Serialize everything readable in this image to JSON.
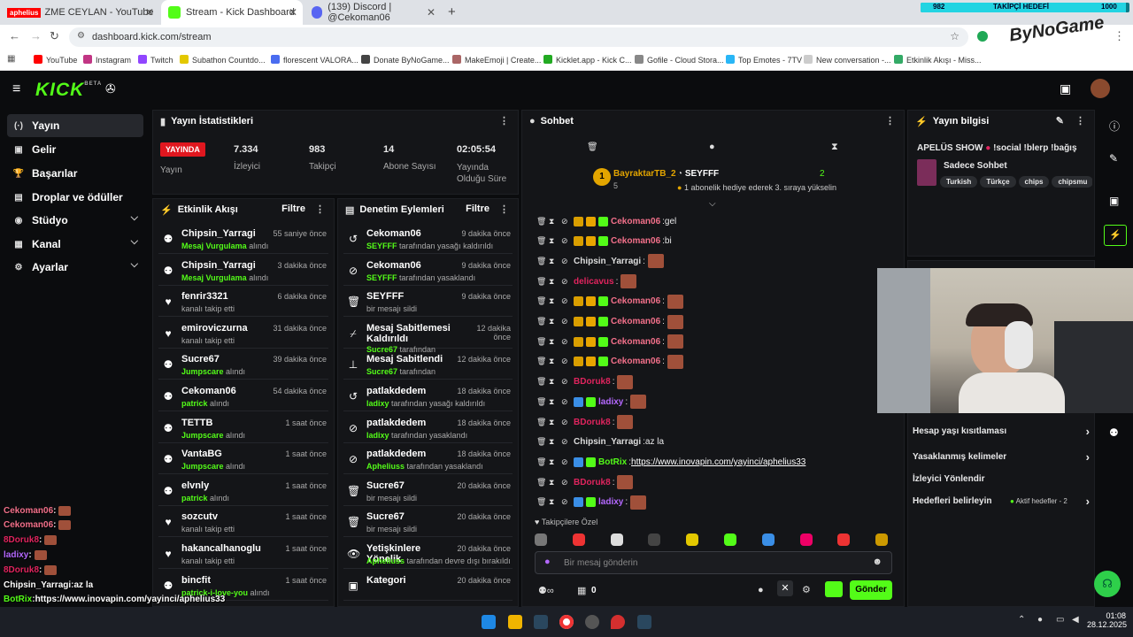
{
  "browser": {
    "tabs": [
      {
        "label": "ZME CEYLAN - YouTube",
        "prefix": "aphelius",
        "color": "#ff0000"
      },
      {
        "label": "Stream - Kick Dashboard",
        "color": "#53fc18"
      },
      {
        "label": "(139) Discord | @Cekoman06",
        "color": "#5865f2"
      }
    ],
    "new_tab": "+",
    "url": "dashboard.kick.com/stream",
    "bookmarks": [
      "YouTube",
      "Instagram",
      "Twitch",
      "Subathon Countdo...",
      "florescent VALORA...",
      "Donate ByNoGame...",
      "MakeEmoji | Create...",
      "Kicklet.app - Kick C...",
      "Gofile - Cloud Stora...",
      "Top Emotes - 7TV",
      "New conversation -...",
      "Etkinlik Akışı - Miss..."
    ]
  },
  "follower_goal": {
    "current": "982",
    "label": "TAKİPÇİ HEDEFİ",
    "target": "1000",
    "progress": 0.982
  },
  "brand_overlay": "ByNoGame",
  "kick": {
    "logo": "KICK",
    "beta": "BETA"
  },
  "sidebar": [
    {
      "label": "Yayın",
      "icon": "broadcast-icon",
      "glyph": "(·)",
      "active": true
    },
    {
      "label": "Gelir",
      "icon": "revenue-icon",
      "glyph": "▣"
    },
    {
      "label": "Başarılar",
      "icon": "trophy-icon",
      "glyph": "🏆"
    },
    {
      "label": "Droplar ve ödüller",
      "icon": "gift-icon",
      "glyph": "▤"
    },
    {
      "label": "Stüdyo",
      "icon": "studio-icon",
      "glyph": "◉",
      "chevron": true
    },
    {
      "label": "Kanal",
      "icon": "channel-icon",
      "glyph": "▦",
      "chevron": true
    },
    {
      "label": "Ayarlar",
      "icon": "settings-icon",
      "glyph": "⚙",
      "chevron": true
    }
  ],
  "stats": {
    "title": "Yayın İstatistikleri",
    "live_badge": "YAYINDA",
    "items": [
      {
        "value": "",
        "label": "Yayın"
      },
      {
        "value": "7.334",
        "label": "İzleyici"
      },
      {
        "value": "983",
        "label": "Takipçi"
      },
      {
        "value": "14",
        "label": "Abone Sayısı"
      },
      {
        "value": "02:05:54",
        "label": "Yayında Olduğu Süre"
      }
    ]
  },
  "activity": {
    "title": "Etkinlik Akışı",
    "filter": "Filtre",
    "rows": [
      {
        "name": "Chipsin_Yarragi",
        "hl": "Mesaj Vurgulama",
        "rest": " alındı",
        "time": "55 saniye önce",
        "glyph": "⚉"
      },
      {
        "name": "Chipsin_Yarragi",
        "hl": "Mesaj Vurgulama",
        "rest": " alındı",
        "time": "3 dakika önce",
        "glyph": "⚉"
      },
      {
        "name": "fenrir3321",
        "hl": "",
        "rest": "kanalı takip etti",
        "time": "6 dakika önce",
        "glyph": "♥"
      },
      {
        "name": "emiroviczurna",
        "hl": "",
        "rest": "kanalı takip etti",
        "time": "31 dakika önce",
        "glyph": "♥"
      },
      {
        "name": "Sucre67",
        "hl": "Jumpscare",
        "rest": " alındı",
        "time": "39 dakika önce",
        "glyph": "⚉"
      },
      {
        "name": "Cekoman06",
        "hl": "patrick",
        "rest": " alındı",
        "time": "54 dakika önce",
        "glyph": "⚉"
      },
      {
        "name": "TETTB",
        "hl": "Jumpscare",
        "rest": " alındı",
        "time": "1 saat önce",
        "glyph": "⚉"
      },
      {
        "name": "VantaBG",
        "hl": "Jumpscare",
        "rest": " alındı",
        "time": "1 saat önce",
        "glyph": "⚉"
      },
      {
        "name": "elvnly",
        "hl": "patrick",
        "rest": " alındı",
        "time": "1 saat önce",
        "glyph": "⚉"
      },
      {
        "name": "sozcutv",
        "hl": "",
        "rest": "kanalı takip etti",
        "time": "1 saat önce",
        "glyph": "♥"
      },
      {
        "name": "hakancalhanoglu",
        "hl": "",
        "rest": "kanalı takip etti",
        "time": "1 saat önce",
        "glyph": "♥"
      },
      {
        "name": "bincfit",
        "hl": "patrick-i-love-you",
        "rest": " alındı",
        "time": "1 saat önce",
        "glyph": "⚉"
      }
    ]
  },
  "moderation": {
    "title": "Denetim Eylemleri",
    "filter": "Filtre",
    "rows": [
      {
        "name": "Cekoman06",
        "hl": "SEYFFF",
        "rest": " tarafından yasağı kaldırıldı",
        "time": "9 dakika önce",
        "glyph": "↺"
      },
      {
        "name": "Cekoman06",
        "hl": "SEYFFF",
        "rest": " tarafından yasaklandı",
        "time": "9 dakika önce",
        "glyph": "⊘"
      },
      {
        "name": "SEYFFF",
        "hl": "",
        "rest": "bir mesajı sildi",
        "time": "9 dakika önce",
        "glyph": "🗑"
      },
      {
        "name": "Mesaj Sabitlemesi Kaldırıldı",
        "hl": "Sucre67",
        "rest": " tarafından",
        "time": "12 dakika önce",
        "glyph": "⌿"
      },
      {
        "name": "Mesaj Sabitlendi",
        "hl": "Sucre67",
        "rest": " tarafından",
        "time": "12 dakika önce",
        "glyph": "⊥"
      },
      {
        "name": "patlakdedem",
        "hl": "ladixy",
        "rest": " tarafından yasağı kaldırıldı",
        "time": "18 dakika önce",
        "glyph": "↺"
      },
      {
        "name": "patlakdedem",
        "hl": "ladixy",
        "rest": " tarafından yasaklandı",
        "time": "18 dakika önce",
        "glyph": "⊘"
      },
      {
        "name": "patlakdedem",
        "hl": "Apheliuss",
        "rest": " tarafından yasaklandı",
        "time": "18 dakika önce",
        "glyph": "⊘"
      },
      {
        "name": "Sucre67",
        "hl": "",
        "rest": "bir mesajı sildi",
        "time": "20 dakika önce",
        "glyph": "🗑"
      },
      {
        "name": "Sucre67",
        "hl": "",
        "rest": "bir mesajı sildi",
        "time": "20 dakika önce",
        "glyph": "🗑"
      },
      {
        "name": "Yetişkinlere Yönelik",
        "hl": "Apheliuss",
        "rest": " tarafından devre dışı bırakıldı",
        "time": "20 dakika önce",
        "glyph": "👁"
      },
      {
        "name": "Kategori",
        "hl": "",
        "rest": "",
        "time": "20 dakika önce",
        "glyph": "▣"
      }
    ]
  },
  "chat": {
    "title": "Sohbet",
    "pinned": {
      "user1": "BayraktarTB_2",
      "count1": "5",
      "user2": "SEYFFF",
      "count2": "2",
      "desc": "1 abonelik hediye ederek 3. sıraya yükselin",
      "rank": "1"
    },
    "lines": [
      {
        "user": "Cekoman06",
        "color": "#f2708a",
        "text": "gel",
        "emote": false,
        "badges": [
          "#d99e00",
          "#e8a500",
          "#53fc18"
        ]
      },
      {
        "user": "Cekoman06",
        "color": "#f2708a",
        "text": "bi",
        "emote": false,
        "badges": [
          "#d99e00",
          "#e8a500",
          "#53fc18"
        ]
      },
      {
        "user": "Chipsin_Yarragi",
        "color": "#dddddd",
        "text": "",
        "emote": true,
        "badges": []
      },
      {
        "user": "delicavus",
        "color": "#e0245e",
        "text": "",
        "emote": true,
        "badges": []
      },
      {
        "user": "Cekoman06",
        "color": "#f2708a",
        "text": "",
        "emote": true,
        "badges": [
          "#d99e00",
          "#e8a500",
          "#53fc18"
        ]
      },
      {
        "user": "Cekoman06",
        "color": "#f2708a",
        "text": "",
        "emote": true,
        "badges": [
          "#d99e00",
          "#e8a500",
          "#53fc18"
        ]
      },
      {
        "user": "Cekoman06",
        "color": "#f2708a",
        "text": "",
        "emote": true,
        "badges": [
          "#d99e00",
          "#e8a500",
          "#53fc18"
        ]
      },
      {
        "user": "Cekoman06",
        "color": "#f2708a",
        "text": "",
        "emote": true,
        "badges": [
          "#d99e00",
          "#e8a500",
          "#53fc18"
        ]
      },
      {
        "user": "BDoruk8",
        "color": "#e0245e",
        "text": "",
        "emote": true,
        "badges": []
      },
      {
        "user": "ladixy",
        "color": "#b468ff",
        "text": "",
        "emote": true,
        "badges": [
          "#3a8ee6",
          "#53fc18"
        ]
      },
      {
        "user": "BDoruk8",
        "color": "#e0245e",
        "text": "",
        "emote": true,
        "badges": []
      },
      {
        "user": "Chipsin_Yarragi",
        "color": "#dddddd",
        "text": "az la",
        "emote": false,
        "badges": []
      },
      {
        "user": "BotRix",
        "color": "#53fc18",
        "text": "https://www.inovapin.com/yayinci/aphelius33",
        "emote": false,
        "link": true,
        "badges": [
          "#3a8ee6",
          "#53fc18"
        ]
      },
      {
        "user": "BDoruk8",
        "color": "#e0245e",
        "text": "",
        "emote": true,
        "badges": []
      },
      {
        "user": "ladixy",
        "color": "#b468ff",
        "text": "",
        "emote": true,
        "badges": [
          "#3a8ee6",
          "#53fc18"
        ]
      }
    ],
    "emote_section": "Takipçilere Özel",
    "input_placeholder": "Bir mesaj gönderin",
    "points": "0",
    "send": "Gönder"
  },
  "stream_info": {
    "title": "Yayın bilgisi",
    "stream_title": "APELÜS SHOW",
    "stream_title_rest": "!social !blerp !bağış",
    "category": "Sadece Sohbet",
    "tags": [
      "Turkish",
      "Türkçe",
      "chips",
      "chipsmu"
    ]
  },
  "settings_list": [
    {
      "label": "Hesap yaşı kısıtlaması",
      "extra": ""
    },
    {
      "label": "Yasaklanmış kelimeler",
      "extra": ""
    },
    {
      "label": "İzleyici Yönlendir",
      "extra": ""
    },
    {
      "label": "Hedefleri belirleyin",
      "extra": "Aktif hedefler - 2"
    }
  ],
  "overlay_chat": [
    {
      "user": "Cekoman06",
      "color": "#f2708a",
      "text": "",
      "emote": true
    },
    {
      "user": "Cekoman06",
      "color": "#f2708a",
      "text": "",
      "emote": true
    },
    {
      "user": "8Doruk8",
      "color": "#e0245e",
      "text": "",
      "emote": true
    },
    {
      "user": "ladixy",
      "color": "#b468ff",
      "text": "",
      "emote": true
    },
    {
      "user": "8Doruk8",
      "color": "#e0245e",
      "text": "",
      "emote": true
    },
    {
      "user": "Chipsin_Yarragi",
      "color": "#ffffff",
      "text": "az la",
      "emote": false
    },
    {
      "user": "BotRix",
      "color": "#53fc18",
      "text": "https://www.inovapin.com/yayinci/aphelius33",
      "emote": false
    },
    {
      "user": "8Doruk8",
      "color": "#e0245e",
      "text": "",
      "emote": true
    },
    {
      "user": "ladixy",
      "color": "#b468ff",
      "text": "",
      "emote": true
    }
  ],
  "taskbar": {
    "time": "01:08",
    "date": "28.12.2025"
  }
}
